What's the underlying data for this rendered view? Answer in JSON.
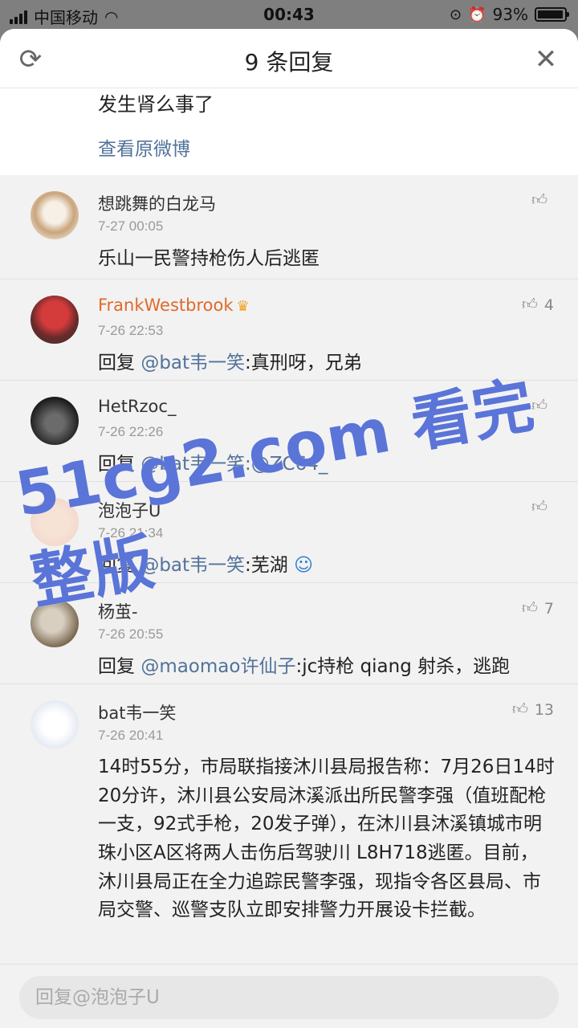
{
  "status": {
    "carrier": "中国移动",
    "time": "00:43",
    "battery": "93%"
  },
  "sheet": {
    "title": "9 条回复",
    "original_text": "发生肾么事了",
    "original_link": "查看原微博"
  },
  "comments": [
    {
      "user": "想跳舞的白龙马",
      "time": "7-27 00:05",
      "likes": "",
      "text": "乐山一民警持枪伤人后逃匿",
      "mention": "",
      "after": ""
    },
    {
      "user": "FrankWestbrook",
      "time": "7-26 22:53",
      "likes": "4",
      "prefix": "回复 ",
      "mention": "@bat韦一笑",
      "after": ":真刑呀，兄弟"
    },
    {
      "user": "HetRzoc_",
      "time": "7-26 22:26",
      "likes": "",
      "prefix": "回复 ",
      "mention": "@bat韦一笑",
      "after": ":@ZC64_"
    },
    {
      "user": "泡泡子U",
      "time": "7-26 21:34",
      "likes": "",
      "prefix": "回复 ",
      "mention": "@bat韦一笑",
      "after": ":芜湖 "
    },
    {
      "user": "杨茧-",
      "time": "7-26 20:55",
      "likes": "7",
      "prefix": "回复 ",
      "mention": "@maomao许仙子",
      "after": ":jc持枪 qiang 射杀，逃跑"
    },
    {
      "user": "bat韦一笑",
      "time": "7-26 20:41",
      "likes": "13",
      "text": "14时55分，市局联指接沐川县局报告称：7月26日14时20分许，沐川县公安局沐溪派出所民警李强（值班配枪一支，92式手枪，20发子弹），在沐川县沐溪镇城市明珠小区A区将两人击伤后驾驶川 L8H718逃匿。目前，沐川县局正在全力追踪民警李强，现指令各区县局、市局交警、巡警支队立即安排警力开展设卡拦截。"
    }
  ],
  "reply": {
    "placeholder": "回复@泡泡子U"
  },
  "watermark": "51cg2.com 看完整版",
  "colors": {
    "link": "#52729a",
    "vip_name": "#e06a2a",
    "watermark": "#5a74d8"
  }
}
